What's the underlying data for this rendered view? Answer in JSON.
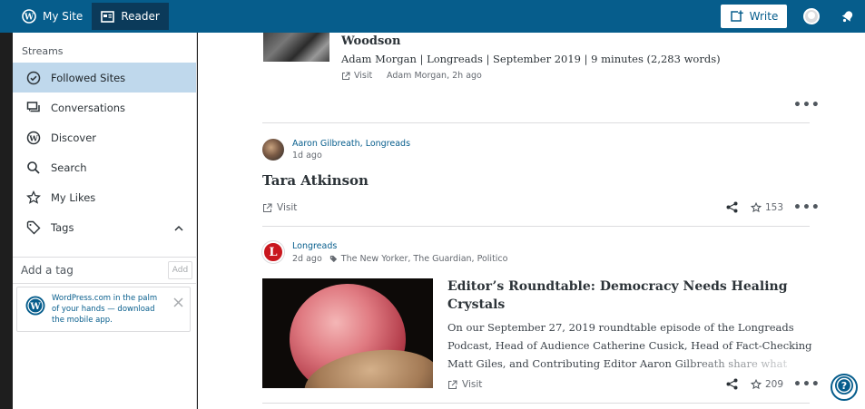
{
  "masterbar": {
    "my_site_label": "My Site",
    "reader_label": "Reader",
    "write_label": "Write",
    "colors": {
      "bar": "#065d8c",
      "active": "#0b3a5a"
    }
  },
  "sidebar": {
    "streams_title": "Streams",
    "items": [
      {
        "label": "Followed Sites",
        "icon": "check-circle-icon",
        "selected": true
      },
      {
        "label": "Conversations",
        "icon": "conversations-icon"
      },
      {
        "label": "Discover",
        "icon": "wordpress-icon"
      },
      {
        "label": "Search",
        "icon": "search-icon"
      },
      {
        "label": "My Likes",
        "icon": "star-icon"
      },
      {
        "label": "Tags",
        "icon": "tag-icon"
      }
    ],
    "tag_input_placeholder": "Add a tag",
    "tag_add_label": "Add",
    "promo_text": "WordPress.com in the palm of your hands — download the mobile app."
  },
  "feed": {
    "top_post": {
      "title": "Woodson",
      "meta": "Adam Morgan | Longreads | September 2019 | 9 minutes (2,283 words)",
      "visit_label": "Visit",
      "byline": "Adam Morgan, 2h ago"
    },
    "post1": {
      "author": "Aaron Gilbreath, Longreads",
      "time": "1d ago",
      "title": "Tara Atkinson",
      "visit_label": "Visit",
      "likes": "153"
    },
    "post2": {
      "site": "Longreads",
      "site_initial": "L",
      "time": "2d ago",
      "tags": "The New Yorker, The Guardian, Politico",
      "title": "Editor’s Roundtable: Democracy Needs Healing Crystals",
      "excerpt": "On our September 27, 2019 roundtable episode of the Longreads Podcast, Head of Audience Catherine Cusick, Head of Fact-Checking Matt Giles, and Contributing Editor Aaron Gilbreath share what",
      "visit_label": "Visit",
      "likes": "209"
    },
    "more_label": "•••"
  },
  "help": {
    "label": "?"
  }
}
